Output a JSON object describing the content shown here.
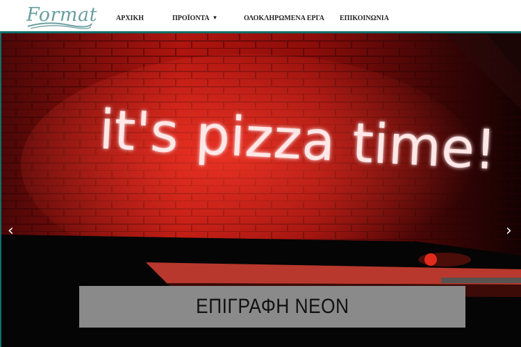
{
  "brand": {
    "logo_text": "Format"
  },
  "nav": {
    "items": [
      {
        "label": "ΑΡΧΙΚΗ"
      },
      {
        "label": "ΠΡΟΪΟΝΤΑ",
        "has_dropdown": true
      },
      {
        "label": "ΟΛΟΚΛΗΡΩΜΕΝΑ ΕΡΓΑ"
      },
      {
        "label": "ΕΠΙΚΟΙΝΩΝΙΑ"
      }
    ]
  },
  "slider": {
    "image_text": "it's pizza time!",
    "caption": "ΕΠΙΓΡΑΦΗ ΝΕΟΝ",
    "prev_icon": "chevron-left-icon",
    "next_icon": "chevron-right-icon"
  },
  "colors": {
    "accent": "#0e6f6a",
    "logo": "#6a9fa0",
    "neon": "#ffe7e7",
    "caption_bg": "#8a8a8a"
  }
}
